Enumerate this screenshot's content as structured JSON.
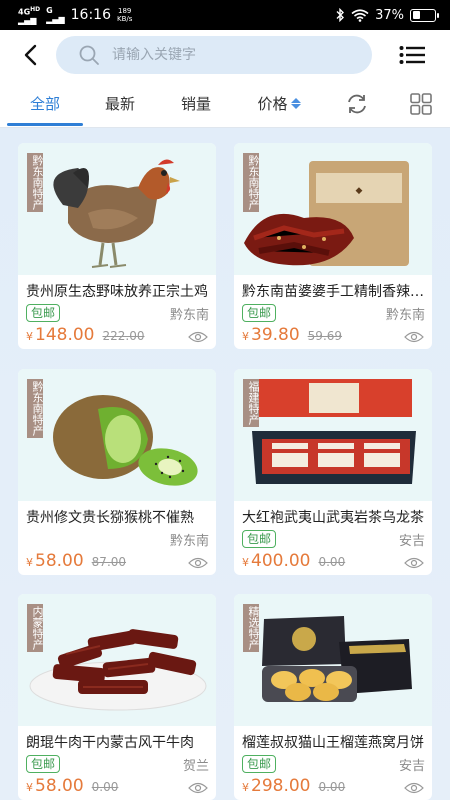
{
  "status_bar": {
    "network": "4G",
    "hd": "HD",
    "g": "G",
    "time": "16:16",
    "speed_value": "189",
    "speed_unit": "KB/s",
    "battery": "37%",
    "battery_level": 0.37
  },
  "search": {
    "placeholder": "请输入关键字",
    "value": ""
  },
  "tabs": [
    {
      "label": "全部"
    },
    {
      "label": "最新"
    },
    {
      "label": "销量"
    },
    {
      "label": "价格"
    }
  ],
  "products": [
    {
      "region": "黔东南特产",
      "title": "贵州原生态野味放养正宗土鸡",
      "badge": "包邮",
      "location": "黔东南",
      "price": "148.00",
      "old_price": "222.00",
      "image": "rooster"
    },
    {
      "region": "黔东南特产",
      "title": "黔东南苗婆婆手工精制香辣牛肉干",
      "badge": "包邮",
      "location": "黔东南",
      "price": "39.80",
      "old_price": "59.69",
      "image": "spicy-beef-jerky"
    },
    {
      "region": "黔东南特产",
      "title": "贵州修文贵长猕猴桃不催熟",
      "badge": "",
      "location": "黔东南",
      "price": "58.00",
      "old_price": "87.00",
      "image": "kiwi"
    },
    {
      "region": "福建特产",
      "title": "大红袍武夷山武夷岩茶乌龙茶",
      "badge": "包邮",
      "location": "安吉",
      "price": "400.00",
      "old_price": "0.00",
      "image": "tea-gift-box"
    },
    {
      "region": "内蒙特产",
      "title": "朗琨牛肉干内蒙古风干牛肉",
      "badge": "包邮",
      "location": "贺兰",
      "price": "58.00",
      "old_price": "0.00",
      "image": "dried-beef"
    },
    {
      "region": "精选特产",
      "title": "榴莲叔叔猫山王榴莲燕窝月饼",
      "badge": "包邮",
      "location": "安吉",
      "price": "298.00",
      "old_price": "0.00",
      "image": "mooncake-gift-box"
    }
  ],
  "currency": "¥",
  "colors": {
    "accent": "#2f7fd6",
    "price": "#e57a3b",
    "badge": "#3a9a4e",
    "region_tag": "#a88f84"
  }
}
